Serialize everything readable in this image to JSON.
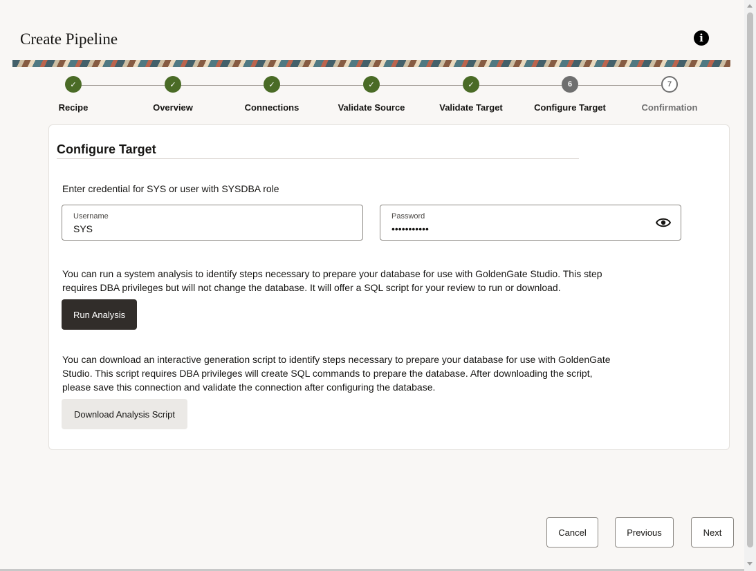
{
  "header": {
    "title": "Create Pipeline",
    "info_icon": "info-icon"
  },
  "stepper": {
    "steps": [
      {
        "label": "Recipe",
        "state": "done",
        "marker": "✓"
      },
      {
        "label": "Overview",
        "state": "done",
        "marker": "✓"
      },
      {
        "label": "Connections",
        "state": "done",
        "marker": "✓"
      },
      {
        "label": "Validate Source",
        "state": "done",
        "marker": "✓"
      },
      {
        "label": "Validate Target",
        "state": "done",
        "marker": "✓"
      },
      {
        "label": "Configure Target",
        "state": "current",
        "marker": "6"
      },
      {
        "label": "Confirmation",
        "state": "future",
        "marker": "7"
      }
    ],
    "colors": {
      "done": "#4a6b26",
      "current": "#6f6f6f"
    }
  },
  "card": {
    "title": "Configure Target",
    "credential_text": "Enter credential for SYS or user with SYSDBA role",
    "username": {
      "label": "Username",
      "value": "SYS"
    },
    "password": {
      "label": "Password",
      "value": "•••••••••••",
      "toggle_icon": "eye-icon"
    },
    "analysis_text_1": "You can run a system analysis to identify steps necessary to prepare your database for use with GoldenGate Studio. This step",
    "analysis_text_2": "requires DBA privileges but will not change the database. It will offer a SQL script for your review to run or download.",
    "run_button": "Run Analysis",
    "download_text_1": "You can download an interactive generation script to identify steps necessary to prepare your database for use with GoldenGate",
    "download_text_2": "Studio. This script requires DBA privileges will create SQL commands to prepare the database. After downloading the script,",
    "download_text_3": "please save this connection and validate the connection after configuring the database.",
    "download_button": "Download Analysis Script"
  },
  "footer": {
    "cancel": "Cancel",
    "previous": "Previous",
    "next": "Next"
  }
}
